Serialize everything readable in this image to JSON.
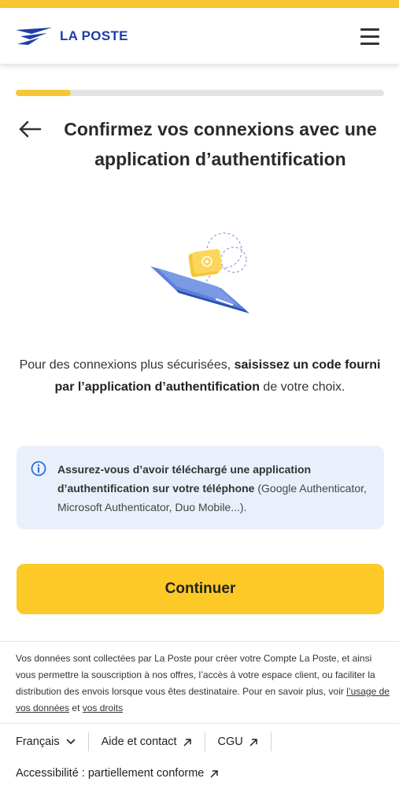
{
  "brand": {
    "logo_text": "LA POSTE",
    "accent_color": "#f6c635",
    "brand_blue": "#1f3da6"
  },
  "header": {
    "menu_icon": "hamburger-menu-icon"
  },
  "progress": {
    "value_percent": 15
  },
  "page": {
    "back_icon": "back-arrow-icon",
    "title": "Confirmez vos connexions avec une application d’authentification"
  },
  "description": {
    "part1": "Pour des connexions plus sécurisées, ",
    "bold": "saisissez un code fourni par l’application d’authentification",
    "part2": " de votre choix."
  },
  "info": {
    "icon": "info-icon",
    "bold": "Assurez-vous d’avoir téléchargé une application d’authentification sur votre téléphone",
    "normal": " (Google Authenticator, Microsoft Authenticator, Duo Mobile...)."
  },
  "actions": {
    "continue_label": "Continuer",
    "button_color": "#fcc927"
  },
  "legal": {
    "text": "Vos données sont collectées par La Poste pour créer votre Compte La Poste, et ainsi vous permettre la souscription à nos offres, l’accès à votre espace client, ou faciliter la distribution des envois lorsque vous êtes destinataire. Pour en savoir plus, voir ",
    "link1": "l’usage de vos données",
    "between": " et ",
    "link2": "vos droits"
  },
  "footer": {
    "language": "Français",
    "help": "Aide et contact",
    "cgu": "CGU",
    "accessibility": "Accessibilité : partiellement conforme"
  }
}
